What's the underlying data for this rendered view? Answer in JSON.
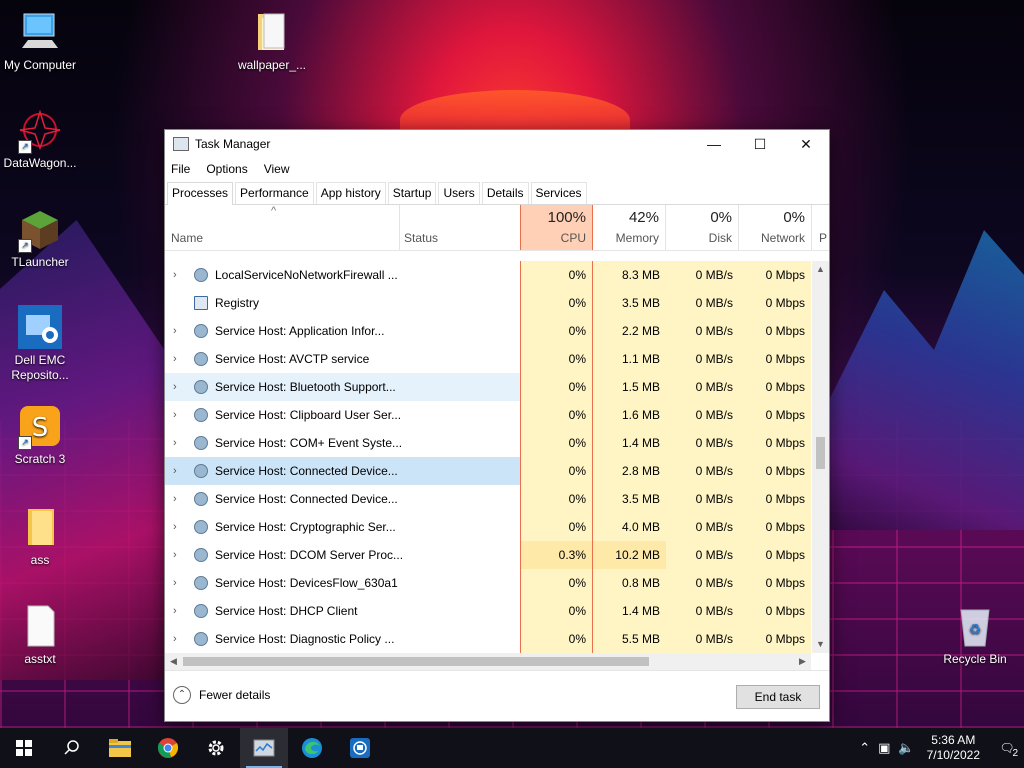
{
  "desktop": {
    "icons": [
      {
        "label": "My Computer"
      },
      {
        "label": "wallpaper_..."
      },
      {
        "label": "DataWagon..."
      },
      {
        "label": "TLauncher"
      },
      {
        "label": "Dell EMC Reposito..."
      },
      {
        "label": "Scratch 3"
      },
      {
        "label": "ass"
      },
      {
        "label": "asstxt"
      },
      {
        "label": "Recycle Bin"
      }
    ]
  },
  "window": {
    "title": "Task Manager",
    "menu": [
      "File",
      "Options",
      "View"
    ],
    "tabs": [
      "Processes",
      "Performance",
      "App history",
      "Startup",
      "Users",
      "Details",
      "Services"
    ],
    "active_tab": "Processes",
    "columns": {
      "name": "Name",
      "status": "Status",
      "cpu": {
        "pct": "100%",
        "label": "CPU"
      },
      "memory": {
        "pct": "42%",
        "label": "Memory"
      },
      "disk": {
        "pct": "0%",
        "label": "Disk"
      },
      "network": {
        "pct": "0%",
        "label": "Network"
      },
      "power_partial": "P"
    },
    "processes": [
      {
        "name": "LocalServiceNoNetworkFirewall ...",
        "cpu": "0%",
        "memory": "8.3 MB",
        "disk": "0 MB/s",
        "network": "0 Mbps",
        "expandable": true,
        "icon": "gear-icon"
      },
      {
        "name": "Registry",
        "cpu": "0%",
        "memory": "3.5 MB",
        "disk": "0 MB/s",
        "network": "0 Mbps",
        "expandable": false,
        "icon": "registry-icon"
      },
      {
        "name": "Service Host: Application Infor...",
        "cpu": "0%",
        "memory": "2.2 MB",
        "disk": "0 MB/s",
        "network": "0 Mbps",
        "expandable": true,
        "icon": "gear-icon"
      },
      {
        "name": "Service Host: AVCTP service",
        "cpu": "0%",
        "memory": "1.1 MB",
        "disk": "0 MB/s",
        "network": "0 Mbps",
        "expandable": true,
        "icon": "gear-icon"
      },
      {
        "name": "Service Host: Bluetooth Support...",
        "cpu": "0%",
        "memory": "1.5 MB",
        "disk": "0 MB/s",
        "network": "0 Mbps",
        "expandable": true,
        "icon": "gear-icon",
        "state": "hover"
      },
      {
        "name": "Service Host: Clipboard User Ser...",
        "cpu": "0%",
        "memory": "1.6 MB",
        "disk": "0 MB/s",
        "network": "0 Mbps",
        "expandable": true,
        "icon": "gear-icon"
      },
      {
        "name": "Service Host: COM+ Event Syste...",
        "cpu": "0%",
        "memory": "1.4 MB",
        "disk": "0 MB/s",
        "network": "0 Mbps",
        "expandable": true,
        "icon": "gear-icon"
      },
      {
        "name": "Service Host: Connected Device...",
        "cpu": "0%",
        "memory": "2.8 MB",
        "disk": "0 MB/s",
        "network": "0 Mbps",
        "expandable": true,
        "icon": "gear-icon",
        "state": "selected"
      },
      {
        "name": "Service Host: Connected Device...",
        "cpu": "0%",
        "memory": "3.5 MB",
        "disk": "0 MB/s",
        "network": "0 Mbps",
        "expandable": true,
        "icon": "gear-icon"
      },
      {
        "name": "Service Host: Cryptographic Ser...",
        "cpu": "0%",
        "memory": "4.0 MB",
        "disk": "0 MB/s",
        "network": "0 Mbps",
        "expandable": true,
        "icon": "gear-icon"
      },
      {
        "name": "Service Host: DCOM Server Proc...",
        "cpu": "0.3%",
        "memory": "10.2 MB",
        "disk": "0 MB/s",
        "network": "0 Mbps",
        "expandable": true,
        "icon": "gear-icon",
        "hot": true
      },
      {
        "name": "Service Host: DevicesFlow_630a1",
        "cpu": "0%",
        "memory": "0.8 MB",
        "disk": "0 MB/s",
        "network": "0 Mbps",
        "expandable": true,
        "icon": "gear-icon"
      },
      {
        "name": "Service Host: DHCP Client",
        "cpu": "0%",
        "memory": "1.4 MB",
        "disk": "0 MB/s",
        "network": "0 Mbps",
        "expandable": true,
        "icon": "gear-icon"
      },
      {
        "name": "Service Host: Diagnostic Policy ...",
        "cpu": "0%",
        "memory": "5.5 MB",
        "disk": "0 MB/s",
        "network": "0 Mbps",
        "expandable": true,
        "icon": "gear-icon"
      }
    ],
    "footer": {
      "fewer_details": "Fewer details",
      "end_task": "End task"
    }
  },
  "taskbar": {
    "pinned": [
      "start-icon",
      "search-icon",
      "file-explorer-icon",
      "chrome-icon",
      "settings-icon",
      "task-manager-icon",
      "edge-icon",
      "remote-desktop-icon"
    ],
    "active": "task-manager-icon",
    "clock_time": "5:36 AM",
    "clock_date": "7/10/2022",
    "notification_count": "2"
  },
  "colors": {
    "cpu_header": "#ffd0b5",
    "cpu_border": "#e8704a",
    "cell_heat": "#fff4c4",
    "row_selected": "#cce4f7",
    "row_hover": "#e5f1fb"
  }
}
